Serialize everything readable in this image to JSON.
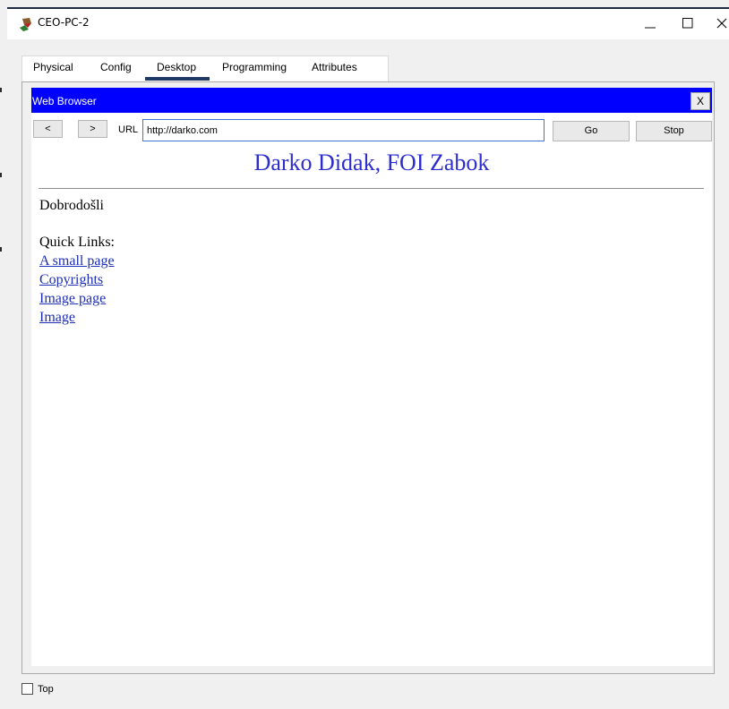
{
  "window": {
    "title": "CEO-PC-2",
    "controls": {
      "minimize_icon": "minimize-icon",
      "maximize_icon": "maximize-icon",
      "close_icon": "close-icon"
    }
  },
  "tabs": [
    {
      "label": "Physical"
    },
    {
      "label": "Config"
    },
    {
      "label": "Desktop"
    },
    {
      "label": "Programming"
    },
    {
      "label": "Attributes"
    }
  ],
  "browser": {
    "title": "Web Browser",
    "close_label": "X",
    "back_label": "<",
    "forward_label": ">",
    "url_label": "URL",
    "url_value": "http://darko.com",
    "go_label": "Go",
    "stop_label": "Stop"
  },
  "page": {
    "heading": "Darko Didak, FOI Zabok",
    "welcome": "Dobrodošli",
    "quick_links_title": "Quick Links:",
    "links": [
      {
        "label": "A small page"
      },
      {
        "label": "Copyrights"
      },
      {
        "label": "Image page"
      },
      {
        "label": "Image"
      }
    ]
  },
  "footer": {
    "checkbox_label": "Top"
  },
  "colors": {
    "browser_header": "#0000ff",
    "heading": "#2e2ecf",
    "link": "#1e2fb3",
    "active_tab": "#1f3864"
  }
}
